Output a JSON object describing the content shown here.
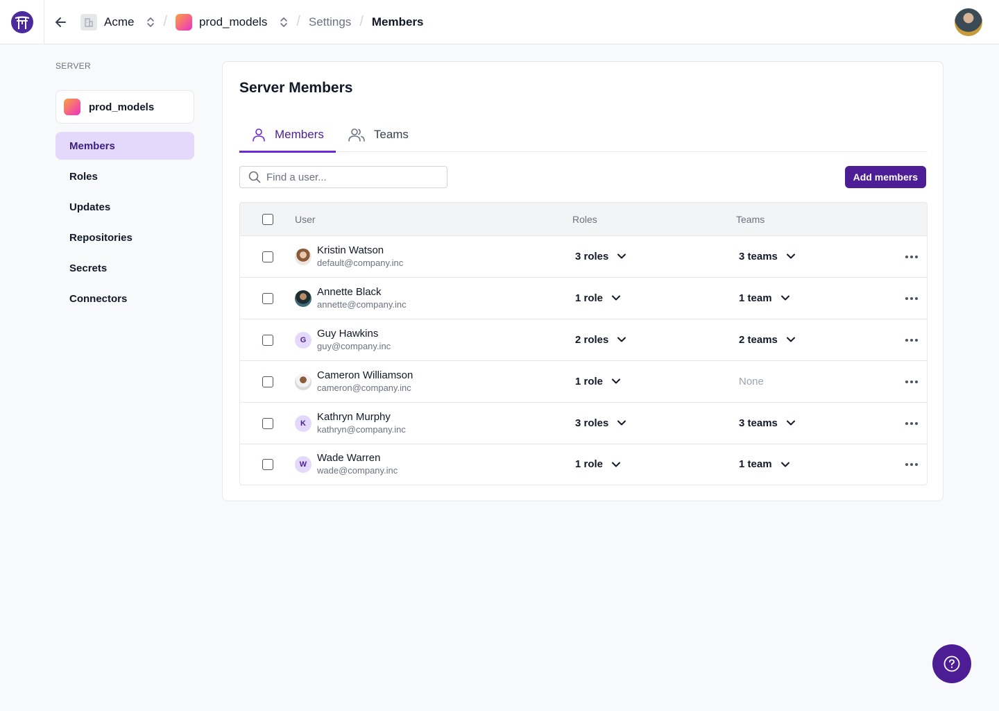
{
  "header": {
    "org": "Acme",
    "server": "prod_models",
    "section": "Settings",
    "page": "Members"
  },
  "sidebar": {
    "label": "SERVER",
    "server_name": "prod_models",
    "items": [
      {
        "label": "Members"
      },
      {
        "label": "Roles"
      },
      {
        "label": "Updates"
      },
      {
        "label": "Repositories"
      },
      {
        "label": "Secrets"
      },
      {
        "label": "Connectors"
      }
    ]
  },
  "main": {
    "title": "Server Members",
    "tabs": [
      {
        "label": "Members"
      },
      {
        "label": "Teams"
      }
    ],
    "search_placeholder": "Find a user...",
    "add_button": "Add members",
    "columns": {
      "user": "User",
      "roles": "Roles",
      "teams": "Teams"
    },
    "members": [
      {
        "name": "Kristin Watson",
        "email": "default@company.inc",
        "roles": "3 roles",
        "teams": "3 teams",
        "avatar": ""
      },
      {
        "name": "Annette Black",
        "email": "annette@company.inc",
        "roles": "1 role",
        "teams": "1 team",
        "avatar": ""
      },
      {
        "name": "Guy Hawkins",
        "email": "guy@company.inc",
        "roles": "2 roles",
        "teams": "2 teams",
        "avatar": "G"
      },
      {
        "name": "Cameron Williamson",
        "email": "cameron@company.inc",
        "roles": "1 role",
        "teams": "None",
        "avatar": ""
      },
      {
        "name": "Kathryn Murphy",
        "email": "kathryn@company.inc",
        "roles": "3 roles",
        "teams": "3 teams",
        "avatar": "K"
      },
      {
        "name": "Wade Warren",
        "email": "wade@company.inc",
        "roles": "1 role",
        "teams": "1 team",
        "avatar": "W"
      }
    ]
  },
  "colors": {
    "accent": "#4c1d95",
    "accent_light": "#e4d9fb",
    "tab_underline": "#6d28d9"
  }
}
